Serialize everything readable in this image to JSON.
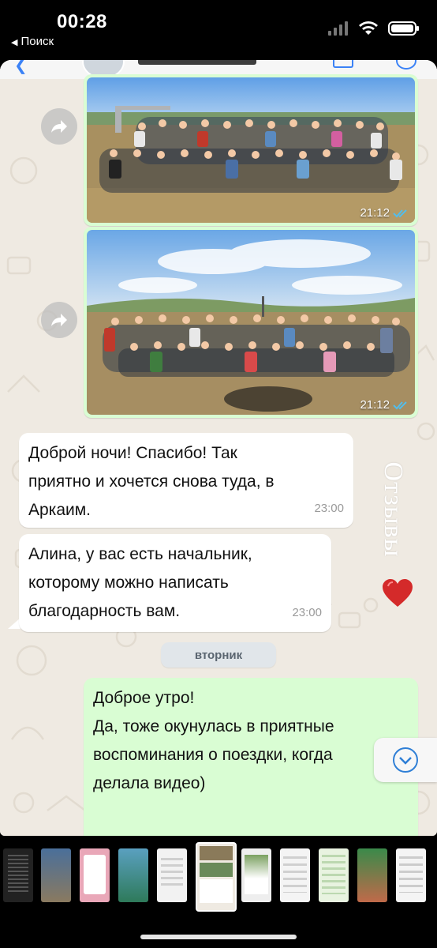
{
  "status_bar": {
    "time": "00:28",
    "back_label": "Поиск"
  },
  "chat": {
    "photos": [
      {
        "time": "21:12",
        "read_status": "double-check-icon"
      },
      {
        "time": "21:12",
        "read_status": "double-check-icon"
      }
    ],
    "incoming": [
      {
        "lines": [
          "Доброй ночи! Спасибо! Так",
          "приятно и хочется снова туда, в",
          "Аркаим."
        ],
        "time": "23:00"
      },
      {
        "lines": [
          "Алина, у вас есть начальник,",
          "которому можно написать",
          "благодарность вам."
        ],
        "time": "23:00"
      }
    ],
    "day_separator": "вторник",
    "outgoing": {
      "lines": [
        "Доброе утро!",
        "Да, тоже окунулась в приятные",
        "воспоминания о поездки, когда",
        "делала видео)"
      ]
    },
    "overlay_text": "Отзывы"
  },
  "colors": {
    "incoming_bubble": "#ffffff",
    "outgoing_bubble": "#d9fdd3",
    "chat_background": "#efeae2",
    "read_ticks": "#53bdeb",
    "heart": "#d42a2a"
  },
  "thumbnails": {
    "count": 12,
    "active_index": 5
  }
}
